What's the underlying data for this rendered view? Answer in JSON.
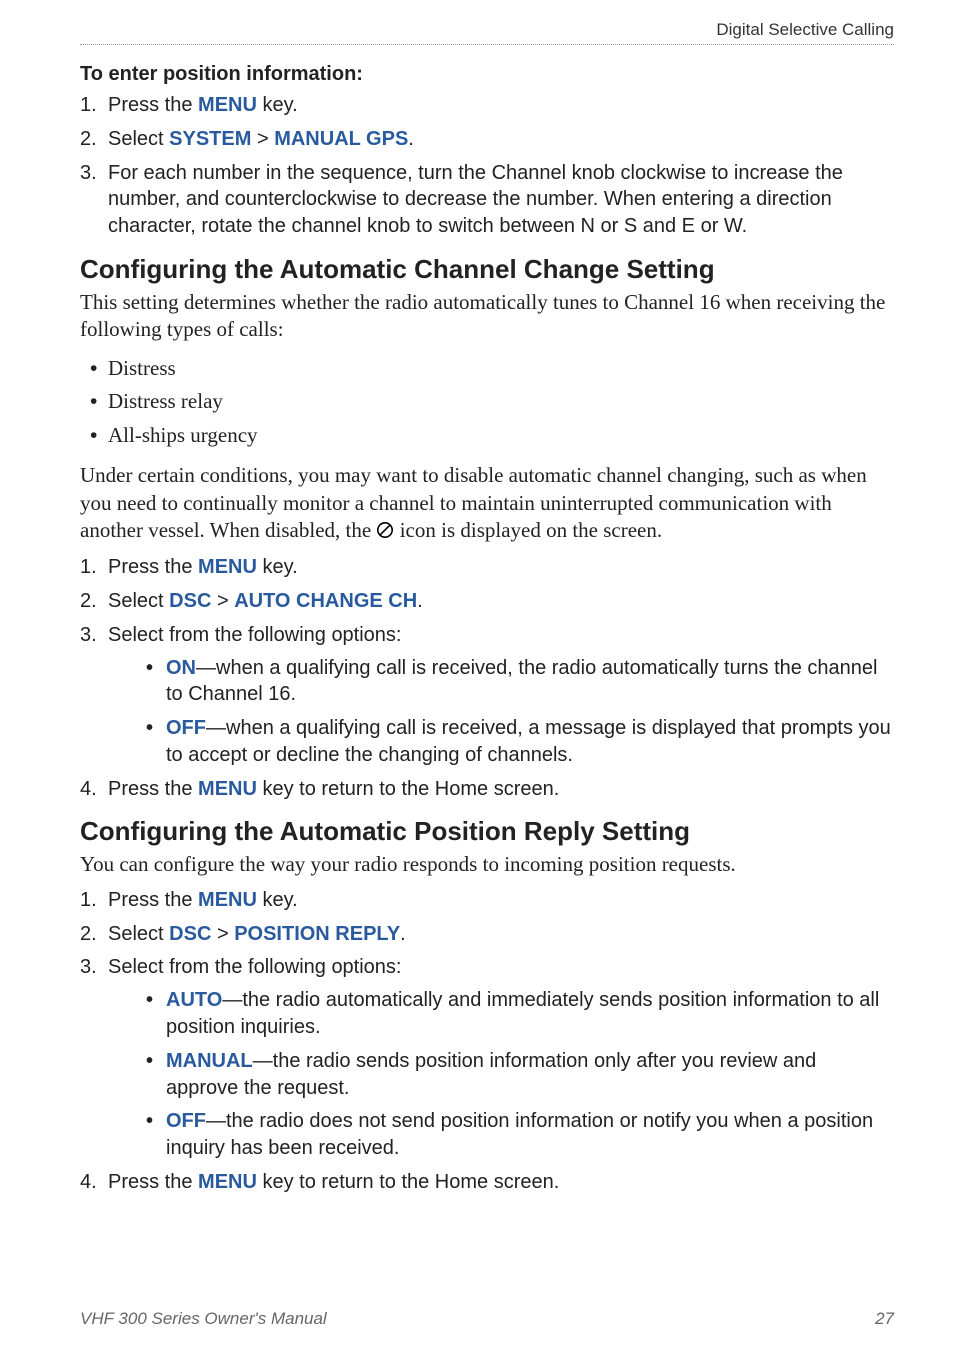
{
  "header": {
    "section_label": "Digital Selective Calling"
  },
  "section1": {
    "title": "To enter position information:",
    "step1": {
      "pre": "Press the ",
      "term1": "MENU",
      "post": " key."
    },
    "step2": {
      "pre": "Select ",
      "term1": "SYSTEM",
      "sep": " > ",
      "term2": "MANUAL GPS",
      "post": "."
    },
    "step3": "For each number in the sequence, turn the Channel knob clockwise to increase the number, and counterclockwise to decrease the number. When entering a direction character, rotate the channel knob to switch between N or S and E or W."
  },
  "section2": {
    "title": "Configuring the Automatic Channel Change Setting",
    "intro": "This setting determines whether the radio automatically tunes to Channel 16 when receiving the following types of calls:",
    "bullets": [
      "Distress",
      "Distress relay",
      "All-ships urgency"
    ],
    "explain_pre": "Under certain conditions, you may want to disable automatic channel changing, such as when you need to continually monitor a channel to maintain uninterrupted communication with another vessel. When disabled, the ",
    "explain_post": " icon is displayed on the screen.",
    "step1": {
      "pre": "Press the ",
      "term1": "MENU",
      "post": " key."
    },
    "step2": {
      "pre": "Select ",
      "term1": "DSC",
      "sep": " > ",
      "term2": "AUTO CHANGE CH",
      "post": "."
    },
    "step3_pre": "Select from the following options:",
    "opt_on": {
      "term": "ON",
      "text": "—when a qualifying call is received, the radio automatically turns the channel to Channel 16."
    },
    "opt_off": {
      "term": "OFF",
      "text": "—when a qualifying call is received, a message is displayed that prompts you to accept or decline the changing of channels."
    },
    "step4": {
      "pre": "Press the ",
      "term1": "MENU",
      "post": " key to return to the Home screen."
    }
  },
  "section3": {
    "title": "Configuring the Automatic Position Reply Setting",
    "intro": "You can configure the way your radio responds to incoming position requests.",
    "step1": {
      "pre": "Press the ",
      "term1": "MENU",
      "post": " key."
    },
    "step2": {
      "pre": "Select ",
      "term1": "DSC",
      "sep": " > ",
      "term2": "POSITION REPLY",
      "post": "."
    },
    "step3_pre": "Select from the following options:",
    "opt_auto": {
      "term": "AUTO",
      "text": "—the radio automatically and immediately sends position information to all position inquiries."
    },
    "opt_manual": {
      "term": "MANUAL",
      "text": "—the radio sends position information only after you review and approve the request."
    },
    "opt_off": {
      "term": "OFF",
      "text": "—the radio does not send position information or notify you when a position inquiry has been received."
    },
    "step4": {
      "pre": "Press the ",
      "term1": "MENU",
      "post": " key to return to the Home screen."
    }
  },
  "footer": {
    "manual_title": "VHF 300 Series Owner's Manual",
    "page_number": "27"
  }
}
